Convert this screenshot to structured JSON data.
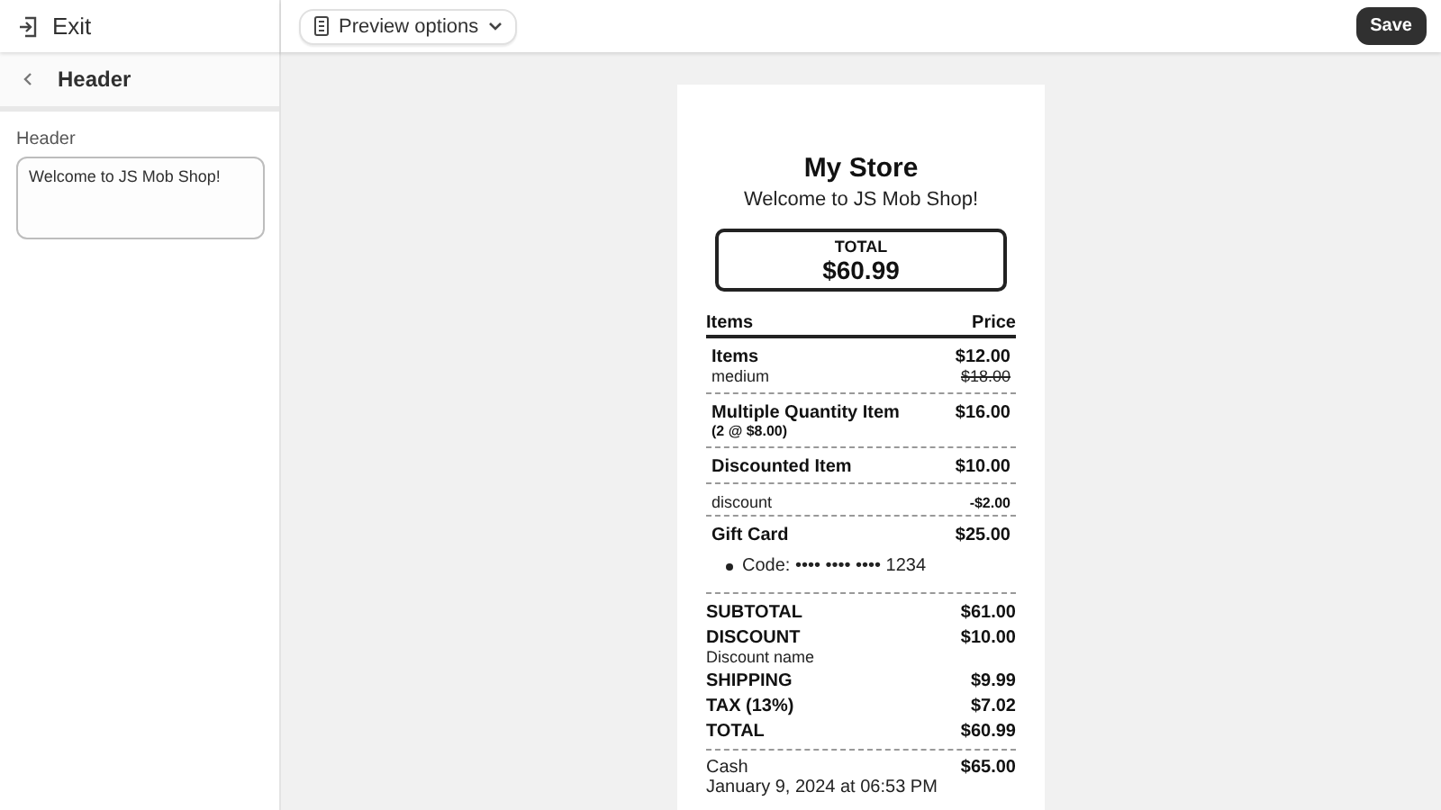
{
  "top_bar": {
    "exit": "Exit",
    "preview_options": "Preview options",
    "save": "Save"
  },
  "panel": {
    "title": "Header",
    "field_label": "Header",
    "field_value": "Welcome to JS Mob Shop!"
  },
  "receipt": {
    "store": "My Store",
    "header": "Welcome to JS Mob Shop!",
    "total_box": {
      "label": "TOTAL",
      "amount": "$60.99"
    },
    "columns": [
      "Items",
      "Price"
    ],
    "line_items": [
      {
        "kind": "item",
        "name": "Items",
        "price": "$12.00",
        "note": "medium",
        "original_price": "$18.00"
      },
      {
        "kind": "quantity",
        "name": "Multiple Quantity Item",
        "price": "$16.00",
        "note": "(2 @ $8.00)"
      },
      {
        "kind": "discounted",
        "name": "Discounted Item",
        "price": "$10.00",
        "discount_label": "discount",
        "discount_amount": "-$2.00"
      },
      {
        "kind": "gift_card",
        "name": "Gift Card",
        "price": "$25.00",
        "code": "Code: •••• •••• •••• 1234"
      }
    ],
    "totals": [
      {
        "label": "SUBTOTAL",
        "amount": "$61.00"
      },
      {
        "label": "DISCOUNT",
        "amount": "$10.00",
        "note": "Discount name"
      },
      {
        "label": "SHIPPING",
        "amount": "$9.99"
      },
      {
        "label": "TAX (13%)",
        "amount": "$7.02"
      },
      {
        "label": "TOTAL",
        "amount": "$60.99"
      }
    ],
    "payment": {
      "method": "Cash",
      "amount": "$65.00",
      "date": "January 9, 2024 at 06:53 PM"
    }
  }
}
